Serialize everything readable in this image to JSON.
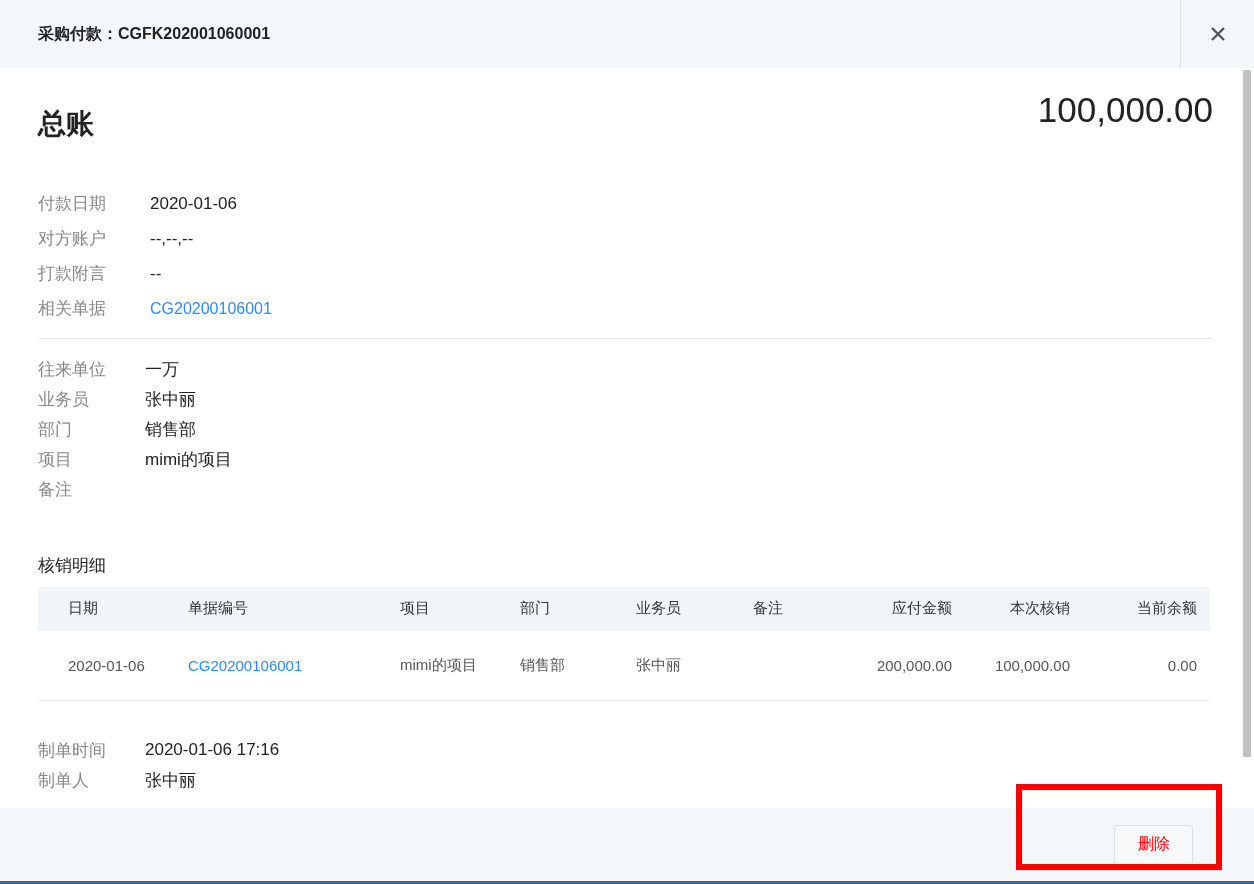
{
  "dialog": {
    "title": "采购付款：CGFK202001060001"
  },
  "summary": {
    "heading": "总账",
    "amount": "100,000.00"
  },
  "payment_fields": [
    {
      "label": "付款日期",
      "value": "2020-01-06",
      "kind": "text"
    },
    {
      "label": "对方账户",
      "value": "--,--,--",
      "kind": "text"
    },
    {
      "label": "打款附言",
      "value": "--",
      "kind": "text"
    },
    {
      "label": "相关单据",
      "value": "CG20200106001",
      "kind": "link"
    }
  ],
  "party_fields": [
    {
      "label": "往来单位",
      "value": "一万"
    },
    {
      "label": "业务员",
      "value": "张中丽"
    },
    {
      "label": "部门",
      "value": "销售部"
    },
    {
      "label": "项目",
      "value": "mimi的项目"
    },
    {
      "label": "备注"
    }
  ],
  "writeoff": {
    "title": "核销明细",
    "columns": [
      "日期",
      "单据编号",
      "项目",
      "部门",
      "业务员",
      "备注",
      "应付金额",
      "本次核销",
      "当前余额"
    ],
    "rows": [
      [
        "2020-01-06",
        "CG20200106001",
        "mimi的项目",
        "销售部",
        "张中丽",
        "",
        "200,000.00",
        "100,000.00",
        "0.00"
      ]
    ]
  },
  "creator_fields": [
    {
      "label": "制单时间",
      "value": "2020-01-06 17:16"
    },
    {
      "label": "制单人",
      "value": "张中丽"
    }
  ],
  "footer": {
    "delete_button": "删除"
  }
}
